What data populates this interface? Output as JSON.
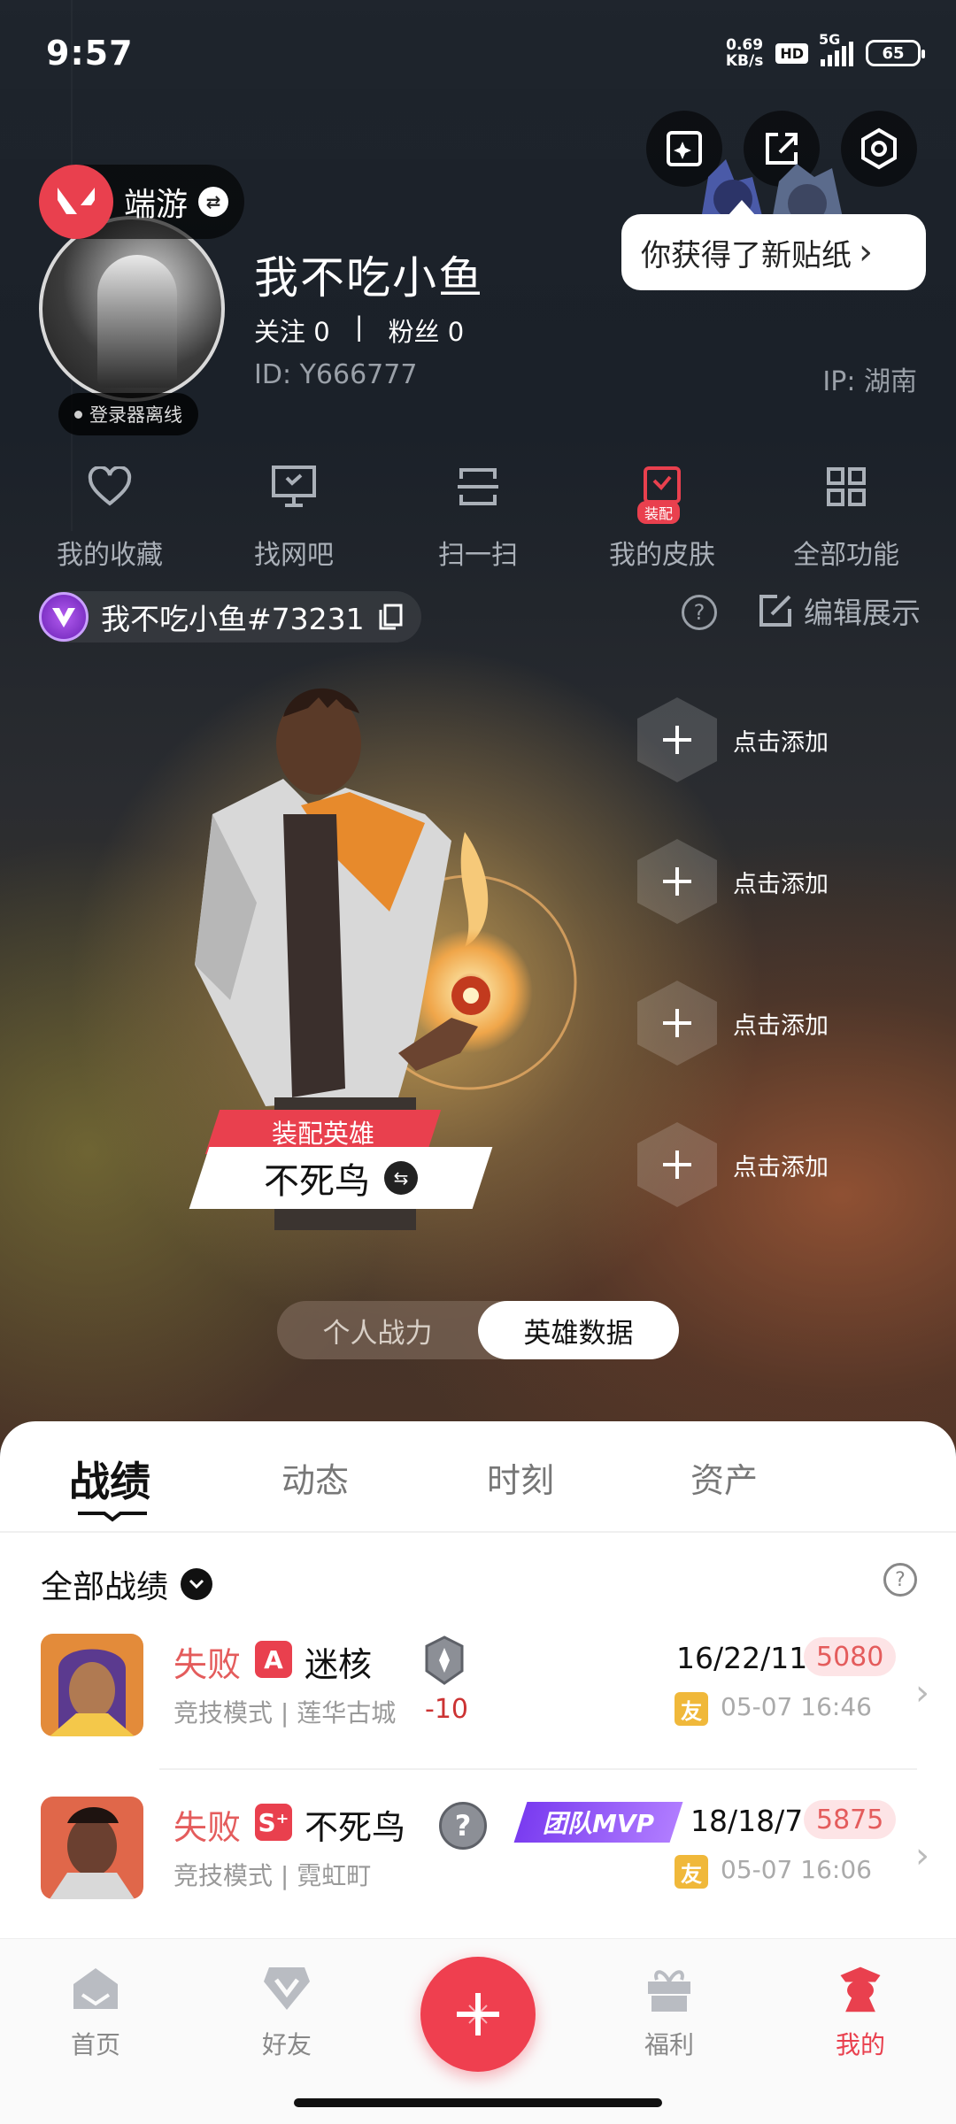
{
  "status_bar": {
    "time": "9:57",
    "speed_value": "0.69",
    "speed_unit": "KB/s",
    "hd": "HD",
    "network": "5G",
    "battery": "65"
  },
  "header": {
    "game_name": "端游",
    "nickname": "我不吃小鱼",
    "follow_label": "关注",
    "follow_count": "0",
    "separator": "|",
    "fans_label": "粉丝",
    "fans_count": "0",
    "user_id": "ID: Y666777",
    "ip": "IP: 湖南",
    "offline_status": "登录器离线",
    "sticker_tip": "你获得了新贴纸",
    "sticker_arrow": "›"
  },
  "quick_functions": [
    {
      "label": "我的收藏",
      "icon": "heart-icon"
    },
    {
      "label": "找网吧",
      "icon": "monitor-icon"
    },
    {
      "label": "扫一扫",
      "icon": "scan-icon"
    },
    {
      "label": "我的皮肤",
      "icon": "skin-icon",
      "badge": "装配"
    },
    {
      "label": "全部功能",
      "icon": "grid-icon"
    }
  ],
  "riot_id": "我不吃小鱼#73231",
  "edit_display": "编辑展示",
  "help_symbol": "?",
  "add_slots": [
    "点击添加",
    "点击添加",
    "点击添加",
    "点击添加"
  ],
  "equipped_hero": {
    "tag": "装配英雄",
    "name": "不死鸟"
  },
  "toggle": {
    "options": [
      "个人战力",
      "英雄数据"
    ],
    "active_index": 1
  },
  "tabs": [
    {
      "label": "战绩",
      "active": true
    },
    {
      "label": "动态",
      "active": false
    },
    {
      "label": "时刻",
      "active": false
    },
    {
      "label": "资产",
      "active": false
    }
  ],
  "filter": {
    "label": "全部战绩"
  },
  "matches": [
    {
      "result": "失败",
      "rank": "A",
      "agent": "迷核",
      "mode": "竞技模式 | 莲华古城",
      "rr_change": "-10",
      "kda": "16/22/11",
      "score": "5080",
      "friend_badge": "友",
      "time": "05-07 16:46"
    },
    {
      "result": "失败",
      "rank": "S⁺",
      "agent": "不死鸟",
      "mode": "竞技模式 | 霓虹町",
      "mvp": "团队MVP",
      "kda": "18/18/7",
      "score": "5875",
      "friend_badge": "友",
      "time": "05-07 16:06"
    }
  ],
  "row_arrow": "›",
  "bottom_nav": [
    {
      "label": "首页",
      "icon": "home-icon",
      "active": false
    },
    {
      "label": "好友",
      "icon": "friends-icon",
      "active": false
    },
    {
      "label": "福利",
      "icon": "gift-icon",
      "active": false
    },
    {
      "label": "我的",
      "icon": "profile-icon",
      "active": true
    }
  ],
  "colors": {
    "accent": "#e9404e",
    "result_loss": "#e45c5c",
    "friend_badge": "#f0b83a"
  }
}
